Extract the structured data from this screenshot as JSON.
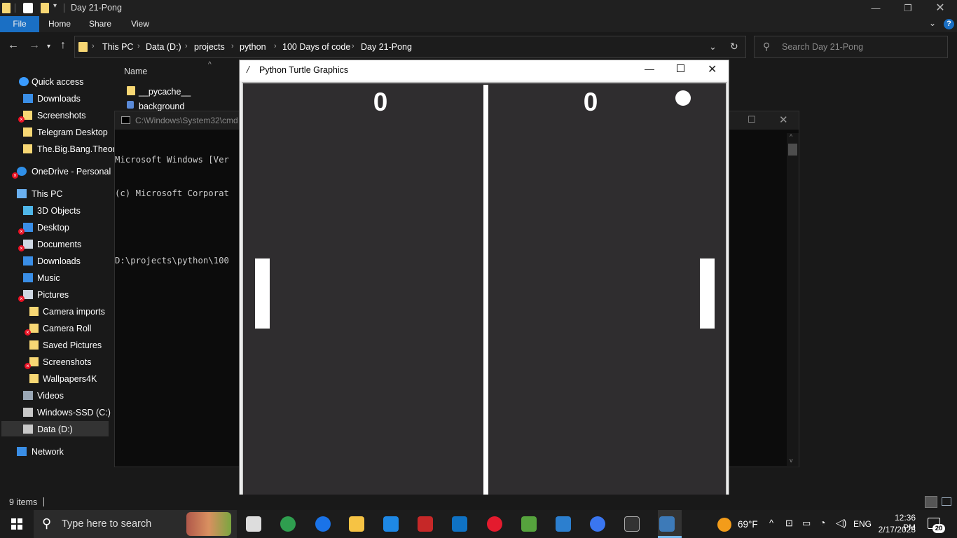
{
  "explorer": {
    "title": "Day 21-Pong",
    "ribbon_tabs": [
      "File",
      "Home",
      "Share",
      "View"
    ],
    "breadcrumbs": [
      "This PC",
      "Data (D:)",
      "projects",
      "python",
      "100 Days of code",
      "Day 21-Pong"
    ],
    "search_placeholder": "Search Day 21-Pong",
    "column_header": "Name",
    "files": [
      "__pycache__",
      "background"
    ],
    "status_items": "9 items",
    "sidebar": {
      "items": [
        {
          "label": "Quick access",
          "icon": "star-icon"
        },
        {
          "label": "Downloads",
          "icon": "download-icon"
        },
        {
          "label": "Screenshots",
          "icon": "folder-icon",
          "error": true
        },
        {
          "label": "Telegram Desktop",
          "icon": "folder-icon"
        },
        {
          "label": "The.Big.Bang.Theor",
          "icon": "folder-icon"
        },
        {
          "label": "OneDrive - Personal",
          "icon": "cloud-icon",
          "error": true
        },
        {
          "label": "This PC",
          "icon": "computer-icon"
        },
        {
          "label": "3D Objects",
          "icon": "cube-icon"
        },
        {
          "label": "Desktop",
          "icon": "desktop-icon",
          "error": true
        },
        {
          "label": "Documents",
          "icon": "documents-icon",
          "error": true
        },
        {
          "label": "Downloads",
          "icon": "download-icon"
        },
        {
          "label": "Music",
          "icon": "music-icon"
        },
        {
          "label": "Pictures",
          "icon": "pictures-icon",
          "error": true
        },
        {
          "label": "Camera imports",
          "icon": "folder-icon"
        },
        {
          "label": "Camera Roll",
          "icon": "folder-icon",
          "error": true
        },
        {
          "label": "Saved Pictures",
          "icon": "folder-icon"
        },
        {
          "label": "Screenshots",
          "icon": "folder-icon",
          "error": true
        },
        {
          "label": "Wallpapers4K",
          "icon": "folder-icon"
        },
        {
          "label": "Videos",
          "icon": "videos-icon"
        },
        {
          "label": "Windows-SSD (C:)",
          "icon": "drive-icon"
        },
        {
          "label": "Data (D:)",
          "icon": "drive-icon",
          "selected": true
        },
        {
          "label": "Network",
          "icon": "network-icon"
        }
      ]
    }
  },
  "cmd": {
    "title": "C:\\Windows\\System32\\cmd",
    "lines": [
      "Microsoft Windows [Ver",
      "(c) Microsoft Corporat",
      "",
      "D:\\projects\\python\\100"
    ]
  },
  "turtle": {
    "title": "Python Turtle Graphics",
    "score_left": "0",
    "score_right": "0",
    "background_color": "#2f2d2f"
  },
  "taskbar": {
    "search_placeholder": "Type here to search",
    "weather": "69°F",
    "language": "ENG",
    "time": "12:36 PM",
    "date": "2/17/2023",
    "notification_count": "20",
    "apps": [
      "task-view-icon",
      "chrome-profile-icon",
      "chrome-icon",
      "file-explorer-icon",
      "launcher-icon",
      "mcafee-icon",
      "vscode-icon",
      "opera-icon",
      "git-icon",
      "photos-icon",
      "signal-icon",
      "terminal-icon",
      "python-icon"
    ]
  }
}
